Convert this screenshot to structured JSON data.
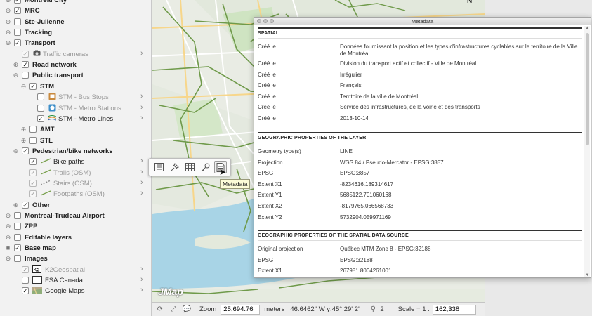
{
  "layers": [
    {
      "label": "Montreal City",
      "bold": true,
      "expander": "plus",
      "checked": true,
      "level": 0
    },
    {
      "label": "MRC",
      "bold": true,
      "expander": "plus",
      "checked": true,
      "level": 0
    },
    {
      "label": "Ste-Julienne",
      "bold": true,
      "expander": "plus",
      "checked": false,
      "level": 0
    },
    {
      "label": "Tracking",
      "bold": true,
      "expander": "plus",
      "checked": false,
      "level": 0
    },
    {
      "label": "Transport",
      "bold": true,
      "expander": "minus",
      "checked": true,
      "level": 0
    },
    {
      "label": "Traffic cameras",
      "bold": false,
      "grey": true,
      "expander": "",
      "checked": true,
      "disabled": true,
      "level": 1,
      "icon": "camera-icon",
      "arrow": true
    },
    {
      "label": "Road network",
      "bold": true,
      "expander": "plus",
      "checked": true,
      "level": 1
    },
    {
      "label": "Public transport",
      "bold": true,
      "expander": "minus",
      "checked": false,
      "level": 1
    },
    {
      "label": "STM",
      "bold": true,
      "expander": "minus",
      "checked": true,
      "level": 2
    },
    {
      "label": "STM - Bus Stops",
      "bold": false,
      "grey": true,
      "expander": "",
      "checked": false,
      "level": 3,
      "icon": "bus-stop-icon",
      "arrow": true
    },
    {
      "label": "STM - Metro Stations",
      "bold": false,
      "grey": true,
      "expander": "",
      "checked": false,
      "level": 3,
      "icon": "metro-station-icon",
      "arrow": true
    },
    {
      "label": "STM - Metro Lines",
      "bold": false,
      "expander": "",
      "checked": true,
      "level": 3,
      "icon": "metro-line-icon",
      "arrow": true
    },
    {
      "label": "AMT",
      "bold": true,
      "expander": "plus",
      "checked": false,
      "level": 2
    },
    {
      "label": "STL",
      "bold": true,
      "expander": "plus",
      "checked": false,
      "level": 2
    },
    {
      "label": "Pedestrian/bike networks",
      "bold": true,
      "expander": "minus",
      "checked": true,
      "level": 1
    },
    {
      "label": "Bike paths",
      "bold": false,
      "expander": "",
      "checked": true,
      "level": 2,
      "icon": "line-icon",
      "arrow": true
    },
    {
      "label": "Trails (OSM)",
      "bold": false,
      "grey": true,
      "expander": "",
      "checked": true,
      "disabled": true,
      "level": 2,
      "icon": "line-icon",
      "arrow": true
    },
    {
      "label": "Stairs (OSM)",
      "bold": false,
      "grey": true,
      "expander": "",
      "checked": true,
      "disabled": true,
      "level": 2,
      "icon": "dash-line-icon",
      "arrow": true
    },
    {
      "label": "Footpaths (OSM)",
      "bold": false,
      "grey": true,
      "expander": "",
      "checked": true,
      "disabled": true,
      "level": 2,
      "icon": "line-icon",
      "arrow": true
    },
    {
      "label": "Other",
      "bold": true,
      "expander": "plus",
      "checked": true,
      "level": 1
    },
    {
      "label": "Montreal-Trudeau Airport",
      "bold": true,
      "expander": "plus",
      "checked": false,
      "level": 0
    },
    {
      "label": "ZPP",
      "bold": true,
      "expander": "plus",
      "checked": false,
      "level": 0
    },
    {
      "label": "Editable layers",
      "bold": true,
      "expander": "plus",
      "checked": false,
      "level": 0
    },
    {
      "label": "Base map",
      "bold": true,
      "expander": "square",
      "checked": true,
      "level": 0
    },
    {
      "label": "Images",
      "bold": true,
      "expander": "plus",
      "checked": false,
      "level": 0
    },
    {
      "label": "K2Geospatial",
      "bold": false,
      "grey": true,
      "expander": "",
      "checked": true,
      "disabled": true,
      "level": 1,
      "icon": "k2-logo-icon",
      "arrow": true
    },
    {
      "label": "FSA Canada",
      "bold": false,
      "expander": "",
      "checked": false,
      "level": 1,
      "icon": "fsa-thumbnail-icon",
      "arrow": true
    },
    {
      "label": "Google Maps",
      "bold": false,
      "expander": "",
      "checked": true,
      "level": 1,
      "icon": "google-maps-thumbnail-icon",
      "arrow": true
    }
  ],
  "map": {
    "logo": "JMap",
    "compass": "N"
  },
  "float_toolbar": {
    "buttons": [
      "list-icon",
      "pin-icon",
      "table-icon",
      "key-icon",
      "metadata-icon"
    ],
    "tooltip": "Metadata"
  },
  "statusbar": {
    "zoom_label": "Zoom",
    "zoom_value": "25,694.76",
    "units": "meters",
    "coords": "46.6462\" W  y:45° 29' 2'",
    "selection_count": "2",
    "scale_label": "Scale = 1 :",
    "scale_value": "162,338"
  },
  "metadata": {
    "window_title": "Metadata",
    "sections": [
      {
        "title": "SPATIAL",
        "rows": [
          {
            "key": "Créé le",
            "value": "Données fournissant la position et les types d'infrastructures cyclables sur le territoire de la Ville de Montréal."
          },
          {
            "key": "Créé le",
            "value": "Division du transport actif et collectif - Ville de Montréal"
          },
          {
            "key": "Créé le",
            "value": "Irrégulier"
          },
          {
            "key": "Créé le",
            "value": "Français"
          },
          {
            "key": "Créé le",
            "value": "Territoire de la ville de Montréal"
          },
          {
            "key": "Créé le",
            "value": "Service des infrastructures, de la voirie et des transports"
          },
          {
            "key": "Créé le",
            "value": "2013-10-14"
          }
        ]
      },
      {
        "title": "GEOGRAPHIC PROPERTIES OF THE LAYER",
        "rows": [
          {
            "key": "Geometry type(s)",
            "value": "LINE"
          },
          {
            "key": "Projection",
            "value": "WGS 84 / Pseudo-Mercator - EPSG:3857"
          },
          {
            "key": "EPSG",
            "value": "EPSG:3857"
          },
          {
            "key": "Extent X1",
            "value": "-8234616.189314617"
          },
          {
            "key": "Extent Y1",
            "value": "5685122.701060168"
          },
          {
            "key": "Extent X2",
            "value": "-8179765.066568733"
          },
          {
            "key": "Extent Y2",
            "value": "5732904.059971169"
          }
        ]
      },
      {
        "title": "GEOGRAPHIC PROPERTIES OF THE SPATIAL DATA SOURCE",
        "rows": [
          {
            "key": "Original projection",
            "value": "Québec MTM Zone 8 - EPSG:32188"
          },
          {
            "key": "EPSG",
            "value": "EPSG:32188"
          },
          {
            "key": "Extent X1",
            "value": "267981.8004261001"
          }
        ]
      }
    ]
  }
}
